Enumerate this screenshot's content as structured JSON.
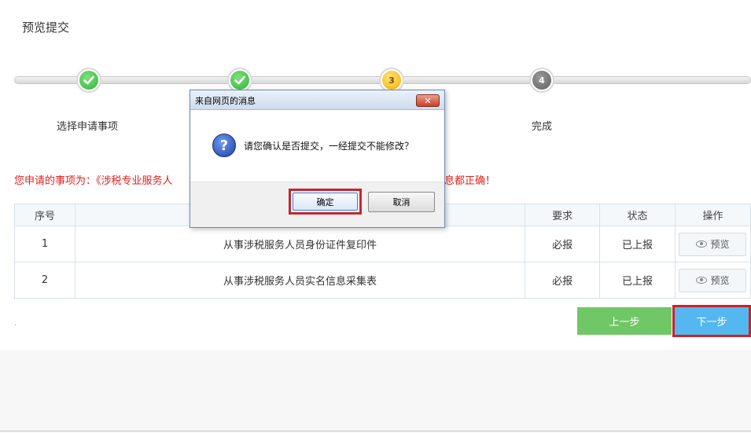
{
  "page": {
    "title": "预览提交"
  },
  "stepper": {
    "steps": [
      {
        "label": "选择申请事项",
        "state": "done",
        "number": ""
      },
      {
        "label": "",
        "state": "done",
        "number": ""
      },
      {
        "label": "",
        "state": "current",
        "number": "3"
      },
      {
        "label": "完成",
        "state": "todo",
        "number": "4"
      }
    ]
  },
  "notice": {
    "text": "您申请的事项为：《涉税专业服务人",
    "tail": "息都正确！"
  },
  "table": {
    "headers": [
      "序号",
      "",
      "要求",
      "状态",
      "操作"
    ],
    "rows": [
      {
        "index": "1",
        "name": "从事涉税服务人员身份证件复印件",
        "requirement": "必报",
        "status": "已上报",
        "action": "预览"
      },
      {
        "index": "2",
        "name": "从事涉税服务人员实名信息采集表",
        "requirement": "必报",
        "status": "已上报",
        "action": "预览"
      }
    ]
  },
  "footer_dot": ".",
  "buttons": {
    "prev": "上一步",
    "next": "下一步"
  },
  "dialog": {
    "title": "来自网页的消息",
    "close": "✕",
    "icon": "question-icon",
    "icon_glyph": "?",
    "message": "请您确认是否提交，一经提交不能修改？",
    "ok": "确定",
    "cancel": "取消"
  },
  "colors": {
    "done": "#2fb53c",
    "current": "#f0b400",
    "todo": "#5e5e5e",
    "notice": "#e0201c",
    "prev": "#6fc765",
    "next": "#55b7f0",
    "highlight": "#c8242c"
  }
}
